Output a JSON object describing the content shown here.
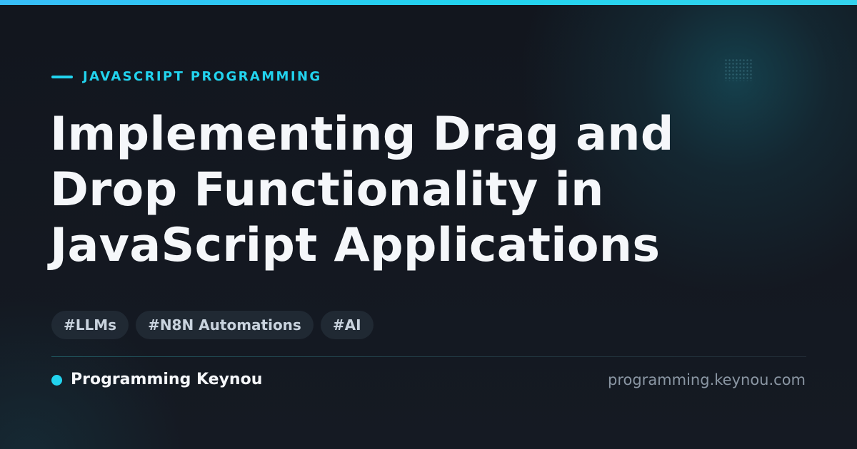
{
  "card": {
    "category": "JAVASCRIPT PROGRAMMING",
    "title": "Implementing Drag and Drop Functionality in JavaScript Applications",
    "tags": [
      "#LLMs",
      "#N8N Automations",
      "#AI"
    ],
    "brand": "Programming Keynou",
    "domain": "programming.keynou.com"
  },
  "colors": {
    "accent": "#22d3ee",
    "background": "#141821",
    "title_text": "#f5f7fa",
    "tag_background": "#1f2933",
    "tag_text": "#c9d3de",
    "muted_text": "#8a96a3"
  },
  "icons": {
    "category_marker": "accent-dash-icon",
    "brand_marker": "accent-dot-icon",
    "decoration": "dot-grid-icon"
  }
}
